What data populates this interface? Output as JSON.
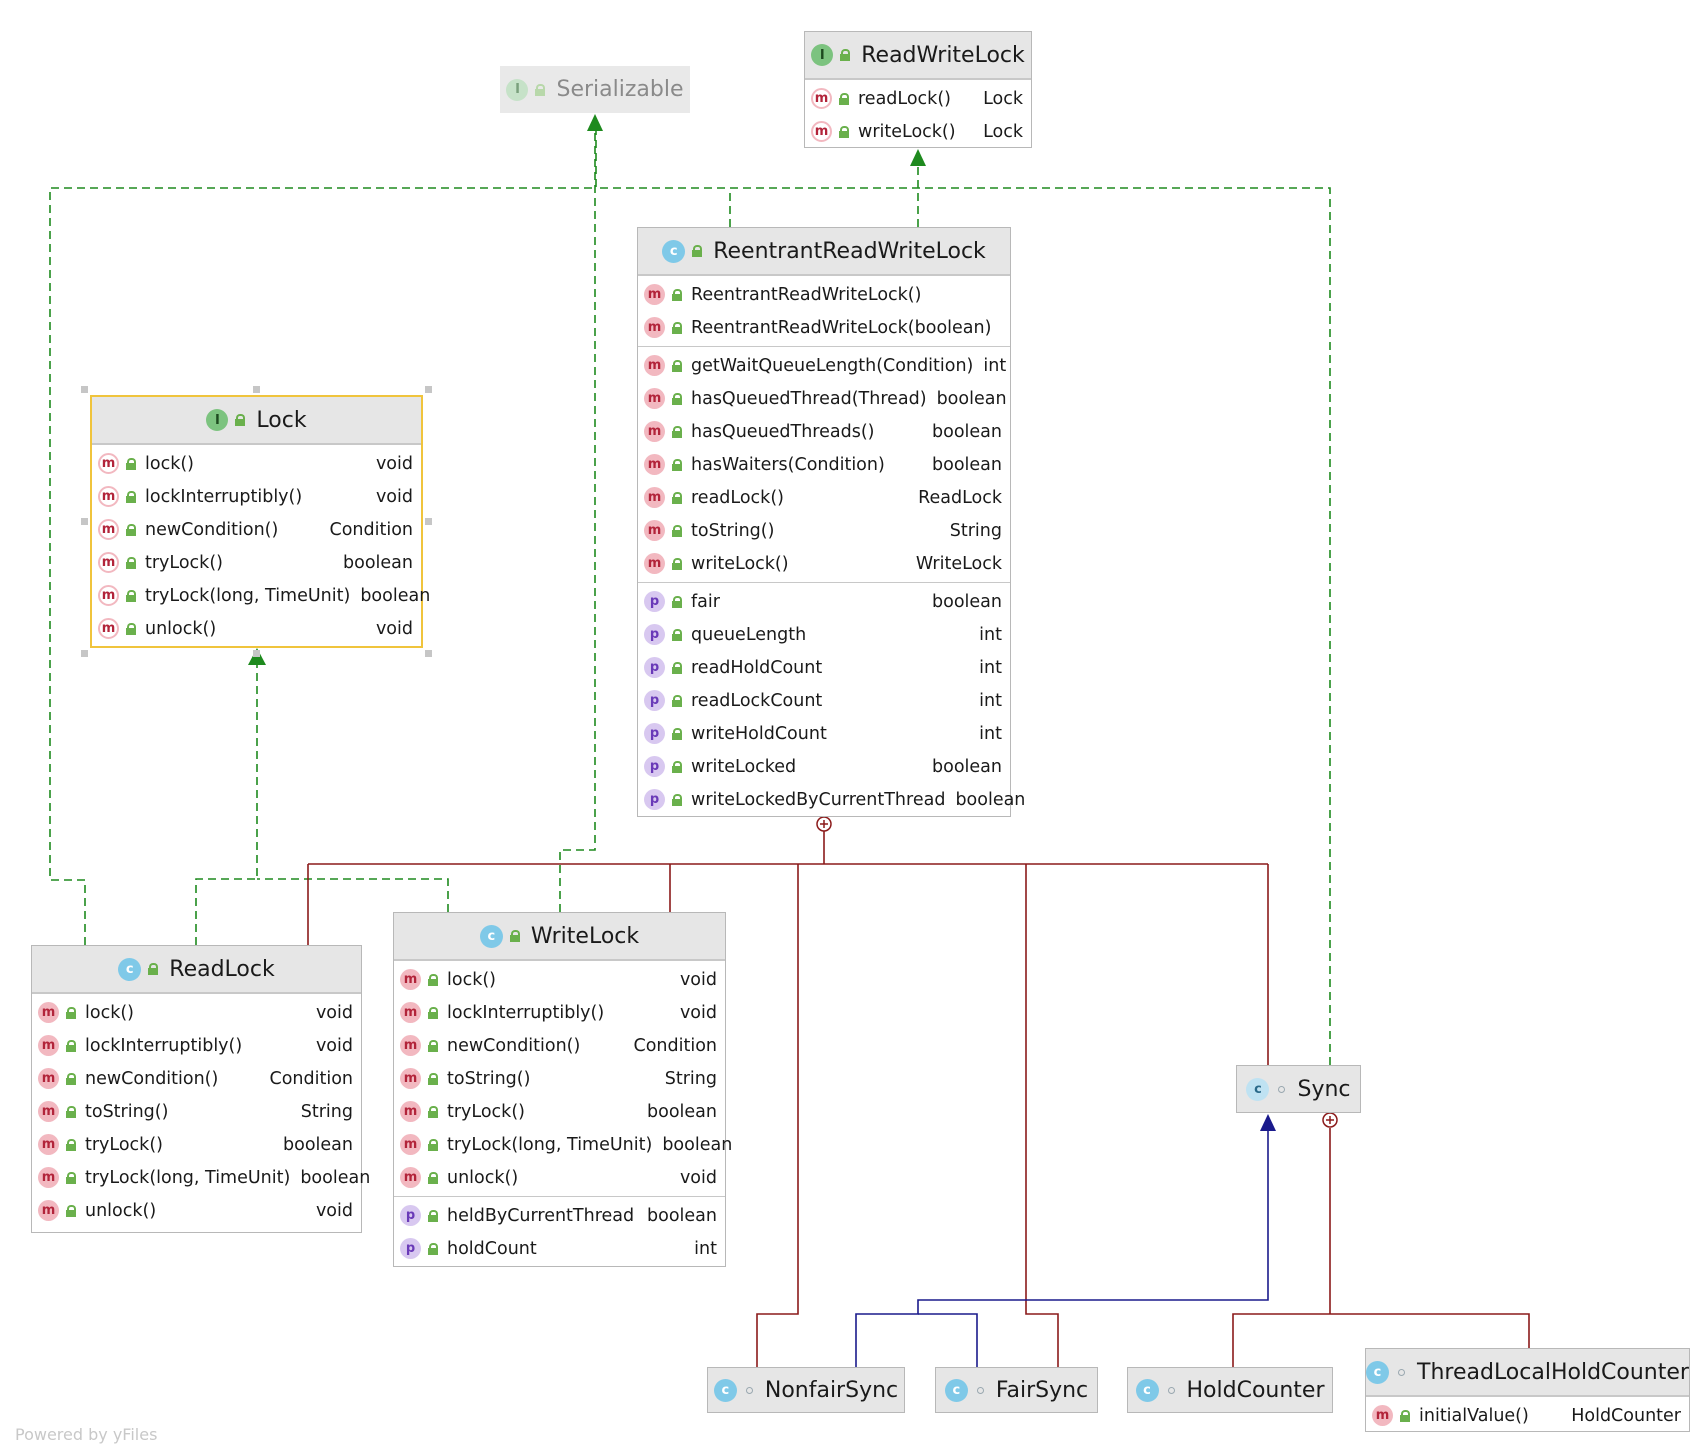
{
  "nodes": {
    "serializable": {
      "title": "Serializable",
      "kind": "I"
    },
    "readwritelock": {
      "title": "ReadWriteLock",
      "kind": "I",
      "members": [
        {
          "kind": "m",
          "name": "readLock()",
          "type": "Lock"
        },
        {
          "kind": "m",
          "name": "writeLock()",
          "type": "Lock"
        }
      ]
    },
    "reentrant": {
      "title": "ReentrantReadWriteLock",
      "kind": "C",
      "constructors": [
        {
          "kind": "m",
          "name": "ReentrantReadWriteLock()",
          "type": ""
        },
        {
          "kind": "m",
          "name": "ReentrantReadWriteLock(boolean)",
          "type": ""
        }
      ],
      "methods": [
        {
          "kind": "m",
          "name": "getWaitQueueLength(Condition)",
          "type": "int"
        },
        {
          "kind": "m",
          "name": "hasQueuedThread(Thread)",
          "type": "boolean"
        },
        {
          "kind": "m",
          "name": "hasQueuedThreads()",
          "type": "boolean"
        },
        {
          "kind": "m",
          "name": "hasWaiters(Condition)",
          "type": "boolean"
        },
        {
          "kind": "m",
          "name": "readLock()",
          "type": "ReadLock"
        },
        {
          "kind": "m",
          "name": "toString()",
          "type": "String"
        },
        {
          "kind": "m",
          "name": "writeLock()",
          "type": "WriteLock"
        }
      ],
      "properties": [
        {
          "kind": "p",
          "name": "fair",
          "type": "boolean"
        },
        {
          "kind": "p",
          "name": "queueLength",
          "type": "int"
        },
        {
          "kind": "p",
          "name": "readHoldCount",
          "type": "int"
        },
        {
          "kind": "p",
          "name": "readLockCount",
          "type": "int"
        },
        {
          "kind": "p",
          "name": "writeHoldCount",
          "type": "int"
        },
        {
          "kind": "p",
          "name": "writeLocked",
          "type": "boolean"
        },
        {
          "kind": "p",
          "name": "writeLockedByCurrentThread",
          "type": "boolean"
        }
      ]
    },
    "lock": {
      "title": "Lock",
      "kind": "I",
      "members": [
        {
          "kind": "m",
          "name": "lock()",
          "type": "void"
        },
        {
          "kind": "m",
          "name": "lockInterruptibly()",
          "type": "void"
        },
        {
          "kind": "m",
          "name": "newCondition()",
          "type": "Condition"
        },
        {
          "kind": "m",
          "name": "tryLock()",
          "type": "boolean"
        },
        {
          "kind": "m",
          "name": "tryLock(long, TimeUnit)",
          "type": "boolean"
        },
        {
          "kind": "m",
          "name": "unlock()",
          "type": "void"
        }
      ]
    },
    "readlock": {
      "title": "ReadLock",
      "kind": "C",
      "members": [
        {
          "kind": "m",
          "name": "lock()",
          "type": "void"
        },
        {
          "kind": "m",
          "name": "lockInterruptibly()",
          "type": "void"
        },
        {
          "kind": "m",
          "name": "newCondition()",
          "type": "Condition"
        },
        {
          "kind": "m",
          "name": "toString()",
          "type": "String"
        },
        {
          "kind": "m",
          "name": "tryLock()",
          "type": "boolean"
        },
        {
          "kind": "m",
          "name": "tryLock(long, TimeUnit)",
          "type": "boolean"
        },
        {
          "kind": "m",
          "name": "unlock()",
          "type": "void"
        }
      ]
    },
    "writelock": {
      "title": "WriteLock",
      "kind": "C",
      "methods": [
        {
          "kind": "m",
          "name": "lock()",
          "type": "void"
        },
        {
          "kind": "m",
          "name": "lockInterruptibly()",
          "type": "void"
        },
        {
          "kind": "m",
          "name": "newCondition()",
          "type": "Condition"
        },
        {
          "kind": "m",
          "name": "toString()",
          "type": "String"
        },
        {
          "kind": "m",
          "name": "tryLock()",
          "type": "boolean"
        },
        {
          "kind": "m",
          "name": "tryLock(long, TimeUnit)",
          "type": "boolean"
        },
        {
          "kind": "m",
          "name": "unlock()",
          "type": "void"
        }
      ],
      "properties": [
        {
          "kind": "p",
          "name": "heldByCurrentThread",
          "type": "boolean"
        },
        {
          "kind": "p",
          "name": "holdCount",
          "type": "int"
        }
      ]
    },
    "sync": {
      "title": "Sync",
      "kind": "C"
    },
    "nonfairsync": {
      "title": "NonfairSync",
      "kind": "C"
    },
    "fairsync": {
      "title": "FairSync",
      "kind": "C"
    },
    "holdcounter": {
      "title": "HoldCounter",
      "kind": "C"
    },
    "threadlocalholdcounter": {
      "title": "ThreadLocalHoldCounter",
      "kind": "C",
      "members": [
        {
          "kind": "m",
          "name": "initialValue()",
          "type": "HoldCounter"
        }
      ]
    }
  },
  "colors": {
    "implements": "#1e8a1e",
    "extends": "#1a1a8c",
    "inner": "#8b1a1a"
  },
  "watermark": "Powered by yFiles"
}
